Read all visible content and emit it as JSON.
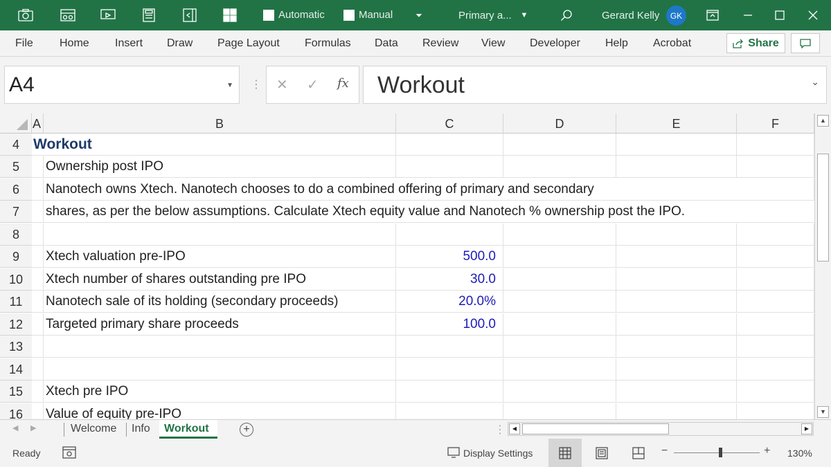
{
  "titlebar": {
    "automatic_label": "Automatic",
    "manual_label": "Manual",
    "file_name": "Primary a...",
    "user_name": "Gerard Kelly",
    "user_initials": "GK"
  },
  "menu": [
    "File",
    "Home",
    "Insert",
    "Draw",
    "Page Layout",
    "Formulas",
    "Data",
    "Review",
    "View",
    "Developer",
    "Help",
    "Acrobat"
  ],
  "share_label": "Share",
  "formula_bar": {
    "name_box": "A4",
    "fx_label": "fx",
    "formula": "Workout"
  },
  "columns": [
    "A",
    "B",
    "C",
    "D",
    "E",
    "F"
  ],
  "rows": [
    {
      "num": "4",
      "b": "Workout",
      "c": ""
    },
    {
      "num": "5",
      "b": "Ownership post IPO",
      "c": ""
    },
    {
      "num": "6",
      "b": "Nanotech owns Xtech. Nanotech chooses to do a combined offering of primary and secondary",
      "c": ""
    },
    {
      "num": "7",
      "b": "shares, as per the below assumptions. Calculate Xtech equity value and Nanotech % ownership post the IPO.",
      "c": ""
    },
    {
      "num": "8",
      "b": "",
      "c": ""
    },
    {
      "num": "9",
      "b": "Xtech valuation pre-IPO",
      "c": "500.0"
    },
    {
      "num": "10",
      "b": "Xtech number of shares outstanding pre IPO",
      "c": "30.0"
    },
    {
      "num": "11",
      "b": "Nanotech sale of its holding (secondary proceeds)",
      "c": "20.0%"
    },
    {
      "num": "12",
      "b": "Targeted primary share proceeds",
      "c": "100.0"
    },
    {
      "num": "13",
      "b": "",
      "c": ""
    },
    {
      "num": "14",
      "b": "",
      "c": ""
    },
    {
      "num": "15",
      "b": "Xtech pre IPO",
      "c": ""
    },
    {
      "num": "16",
      "b": "Value of equity pre-IPO",
      "c": ""
    }
  ],
  "sheets": [
    "Welcome",
    "Info",
    "Workout"
  ],
  "active_sheet": "Workout",
  "status": {
    "ready": "Ready",
    "display_settings": "Display Settings",
    "zoom": "130%"
  },
  "colors": {
    "accent": "#217346",
    "input_blue": "#1c1cb8",
    "header_navy": "#1f3a6b"
  }
}
